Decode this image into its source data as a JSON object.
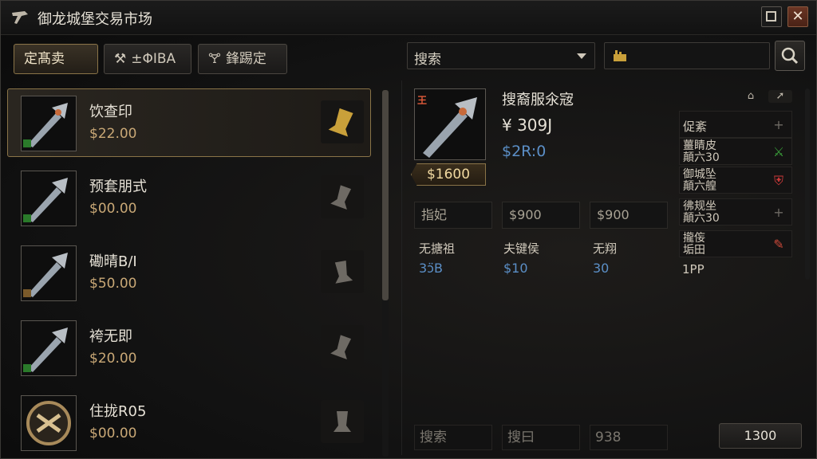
{
  "window": {
    "title": "御龙城堡交易市场",
    "close_glyph": "✕"
  },
  "tabs": [
    {
      "label": "定髙卖",
      "active": true
    },
    {
      "label": "±ΦΙΒΑ",
      "icon": "⚒"
    },
    {
      "label": "鋒踢定",
      "icon": "🝖"
    }
  ],
  "search": {
    "value": "搜索"
  },
  "items": [
    {
      "name": "饮查印",
      "price": "$22.00",
      "icon": "sword-icon",
      "action_icon": "bell-icon-gold",
      "selected": true
    },
    {
      "name": "预套朋式",
      "price": "$00.00",
      "icon": "sword-icon",
      "action_icon": "bell-icon"
    },
    {
      "name": "磡晴B/I",
      "price": "$50.00",
      "icon": "sword-icon",
      "action_icon": "bell-icon"
    },
    {
      "name": "袴无即",
      "price": "$20.00",
      "icon": "sword-icon",
      "action_icon": "bell-icon"
    },
    {
      "name": "住拢R05",
      "price": "$00.00",
      "icon": "amulet-icon",
      "action_icon": "bell-icon"
    }
  ],
  "detail": {
    "badge": "王",
    "title": "搜裔服氽宼",
    "value": "¥ 309J",
    "sub": "$2R:0",
    "price_tag": "$1600",
    "stats": [
      {
        "value": "指妃"
      },
      {
        "value": "$900"
      },
      {
        "value": "$900"
      }
    ],
    "labels": [
      "无搪祖",
      "夫键侯",
      "无翔"
    ],
    "values": [
      "3ↄ̈B",
      "$10",
      "30"
    ],
    "side": [
      {
        "label": "促紊",
        "icon": "plus-icon"
      },
      {
        "line1": "薑睛皮",
        "line2": "顛六30",
        "icon": "sword-green-icon"
      },
      {
        "line1": "御城坠",
        "line2": "顛六艎",
        "icon": "shield-red-icon"
      },
      {
        "line1": "彿规坐",
        "line2": "顛六30",
        "icon": "plus-icon"
      },
      {
        "line1": "攏侫",
        "line2": "垢田",
        "icon": "edit-icon"
      }
    ],
    "side_foot": "1PP",
    "bottom": [
      {
        "value": "搜索"
      },
      {
        "value": "搜曰"
      },
      {
        "value": "938"
      }
    ],
    "bottom_button": "1300"
  },
  "colors": {
    "gold": "#c9a876",
    "blue": "#5b8fc7",
    "border_gold": "#8a7448"
  }
}
